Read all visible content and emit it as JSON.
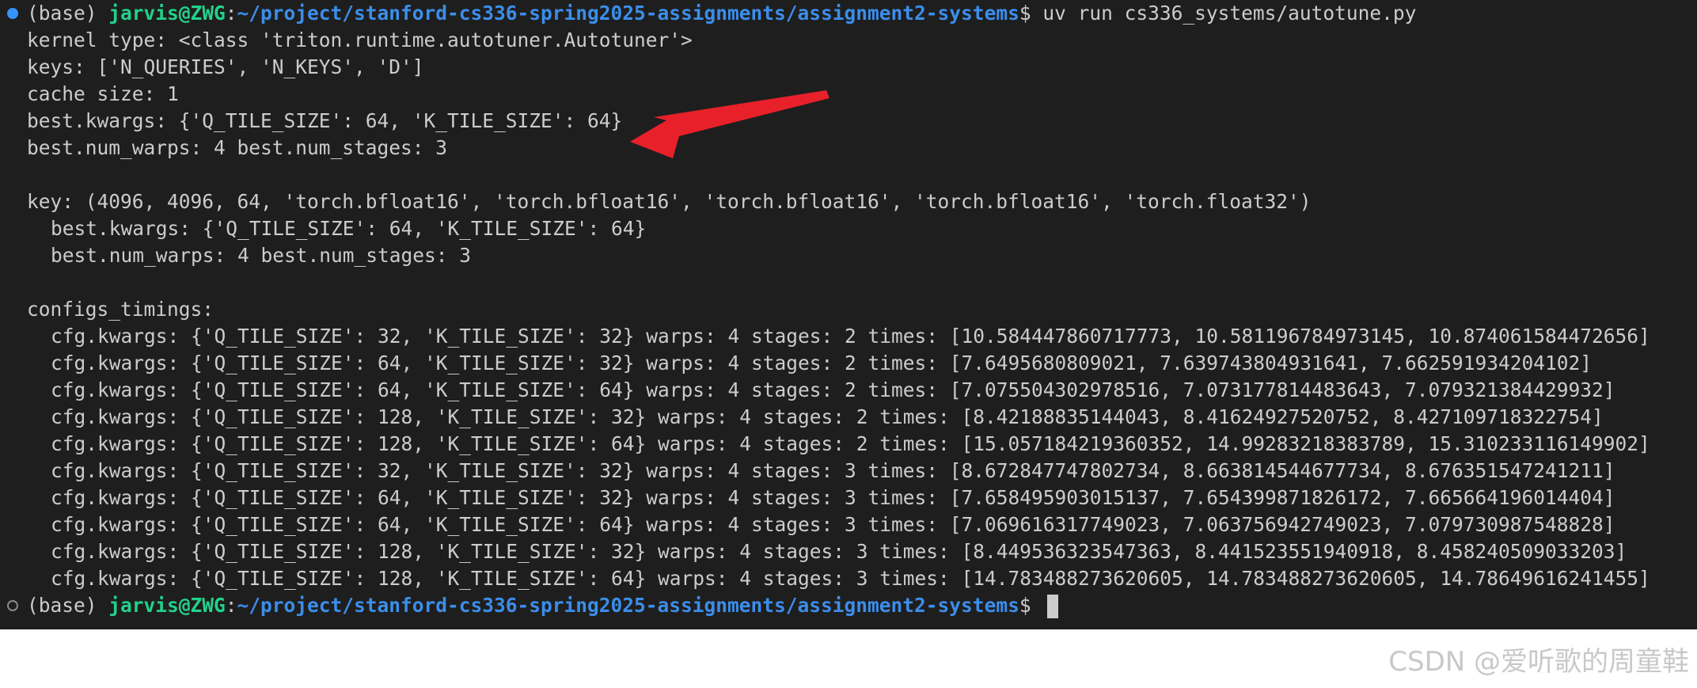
{
  "prompt": {
    "env": "(base) ",
    "user": "jarvis@ZWG",
    "colon": ":",
    "path": "~/project/stanford-cs336-spring2025-assignments/assignment2-systems",
    "symbol": "$ ",
    "command": "uv run cs336_systems/autotune.py"
  },
  "output": {
    "kernel_type": "kernel type: <class 'triton.runtime.autotuner.Autotuner'>",
    "keys": "keys: ['N_QUERIES', 'N_KEYS', 'D']",
    "cache_size": "cache size: 1",
    "best_kwargs": "best.kwargs: {'Q_TILE_SIZE': 64, 'K_TILE_SIZE': 64}",
    "best_warps_stages": "best.num_warps: 4 best.num_stages: 3",
    "key": "key: (4096, 4096, 64, 'torch.bfloat16', 'torch.bfloat16', 'torch.bfloat16', 'torch.bfloat16', 'torch.float32')",
    "key_best_kwargs": "best.kwargs: {'Q_TILE_SIZE': 64, 'K_TILE_SIZE': 64}",
    "key_best_warps_stages": "best.num_warps: 4 best.num_stages: 3",
    "configs_header": "configs_timings:",
    "configs": [
      "cfg.kwargs: {'Q_TILE_SIZE': 32, 'K_TILE_SIZE': 32} warps: 4 stages: 2 times: [10.584447860717773, 10.581196784973145, 10.874061584472656]",
      "cfg.kwargs: {'Q_TILE_SIZE': 64, 'K_TILE_SIZE': 32} warps: 4 stages: 2 times: [7.6495680809021, 7.639743804931641, 7.662591934204102]",
      "cfg.kwargs: {'Q_TILE_SIZE': 64, 'K_TILE_SIZE': 64} warps: 4 stages: 2 times: [7.075504302978516, 7.073177814483643, 7.079321384429932]",
      "cfg.kwargs: {'Q_TILE_SIZE': 128, 'K_TILE_SIZE': 32} warps: 4 stages: 2 times: [8.42188835144043, 8.41624927520752, 8.427109718322754]",
      "cfg.kwargs: {'Q_TILE_SIZE': 128, 'K_TILE_SIZE': 64} warps: 4 stages: 2 times: [15.057184219360352, 14.99283218383789, 15.310233116149902]",
      "cfg.kwargs: {'Q_TILE_SIZE': 32, 'K_TILE_SIZE': 32} warps: 4 stages: 3 times: [8.672847747802734, 8.663814544677734, 8.676351547241211]",
      "cfg.kwargs: {'Q_TILE_SIZE': 64, 'K_TILE_SIZE': 32} warps: 4 stages: 3 times: [7.658495903015137, 7.654399871826172, 7.665664196014404]",
      "cfg.kwargs: {'Q_TILE_SIZE': 64, 'K_TILE_SIZE': 64} warps: 4 stages: 3 times: [7.069616317749023, 7.063756942749023, 7.079730987548828]",
      "cfg.kwargs: {'Q_TILE_SIZE': 128, 'K_TILE_SIZE': 32} warps: 4 stages: 3 times: [8.449536323547363, 8.441523551940918, 8.458240509033203]",
      "cfg.kwargs: {'Q_TILE_SIZE': 128, 'K_TILE_SIZE': 64} warps: 4 stages: 3 times: [14.783488273620605, 14.783488273620605, 14.78649616241455]"
    ]
  },
  "colors": {
    "background": "#1e1e1e",
    "text": "#cccccc",
    "user": "#23d18b",
    "path": "#3b8eea",
    "arrow": "#e8202a",
    "dot_active": "#3794ff"
  },
  "watermark": "CSDN @爱听歌的周童鞋"
}
